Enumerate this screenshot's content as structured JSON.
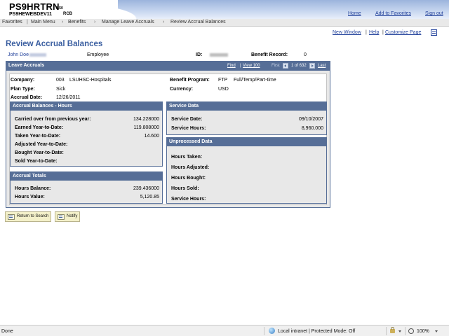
{
  "header": {
    "system_title": "PS9HRTRN",
    "version": "8.50",
    "database": "PS9HEWEBDEV11",
    "node": "RCB",
    "links": {
      "home": "Home",
      "add_to_favorites": "Add to Favorites",
      "sign_out": "Sign out"
    }
  },
  "breadcrumb": [
    "Favorites",
    "Main Menu",
    "Benefits",
    "Manage Leave Accruals",
    "Review Accrual Balances"
  ],
  "page_links": {
    "new_window": "New Window",
    "help": "Help",
    "customize_page": "Customize Page"
  },
  "page_title": "Review Accrual Balances",
  "employee": {
    "name": "John Doe",
    "role": "Employee",
    "id_label": "ID:",
    "benefit_record_label": "Benefit Record:",
    "benefit_record_value": "0"
  },
  "leave_accruals": {
    "title": "Leave Accruals",
    "nav": {
      "find": "Find",
      "view": "View 100",
      "first": "First",
      "range": "1 of 632",
      "last": "Last"
    },
    "company_label": "Company:",
    "company_code": "003",
    "company_name": "LSUHSC-Hospitals",
    "plan_type_label": "Plan Type:",
    "plan_type": "Sick",
    "accrual_date_label": "Accrual Date:",
    "accrual_date": "12/26/2011",
    "benefit_program_label": "Benefit Program:",
    "benefit_program_code": "FTP",
    "benefit_program_name": "Full/Temp/Part-time",
    "currency_label": "Currency:",
    "currency": "USD"
  },
  "accrual_balances": {
    "title": "Accrual Balances - Hours",
    "rows": [
      {
        "label": "Carried over from previous year:",
        "value": "134.228000"
      },
      {
        "label": "Earned Year-to-Date:",
        "value": "119.808000"
      },
      {
        "label": "Taken Year-to-Date:",
        "value": "14.600"
      },
      {
        "label": "Adjusted Year-to-Date:",
        "value": ""
      },
      {
        "label": "Bought Year-to-Date:",
        "value": ""
      },
      {
        "label": "Sold Year-to-Date:",
        "value": ""
      }
    ]
  },
  "accrual_totals": {
    "title": "Accrual Totals",
    "rows": [
      {
        "label": "Hours Balance:",
        "value": "239.436000"
      },
      {
        "label": "Hours Value:",
        "value": "5,120.85"
      }
    ]
  },
  "service_data": {
    "title": "Service Data",
    "rows": [
      {
        "label": "Service Date:",
        "value": "09/10/2007"
      },
      {
        "label": "Service Hours:",
        "value": "8,960.000"
      }
    ]
  },
  "unprocessed_data": {
    "title": "Unprocessed Data",
    "rows": [
      {
        "label": "Hours Taken:"
      },
      {
        "label": "Hours Adjusted:"
      },
      {
        "label": "Hours Bought:"
      },
      {
        "label": "Hours Sold:"
      },
      {
        "label": "Service Hours:"
      }
    ]
  },
  "buttons": {
    "return_to_search": "Return to Search",
    "notify": "Notify"
  },
  "status_bar": {
    "status": "Done",
    "zone": "Local intranet | Protected Mode: Off",
    "zoom": "100%"
  }
}
